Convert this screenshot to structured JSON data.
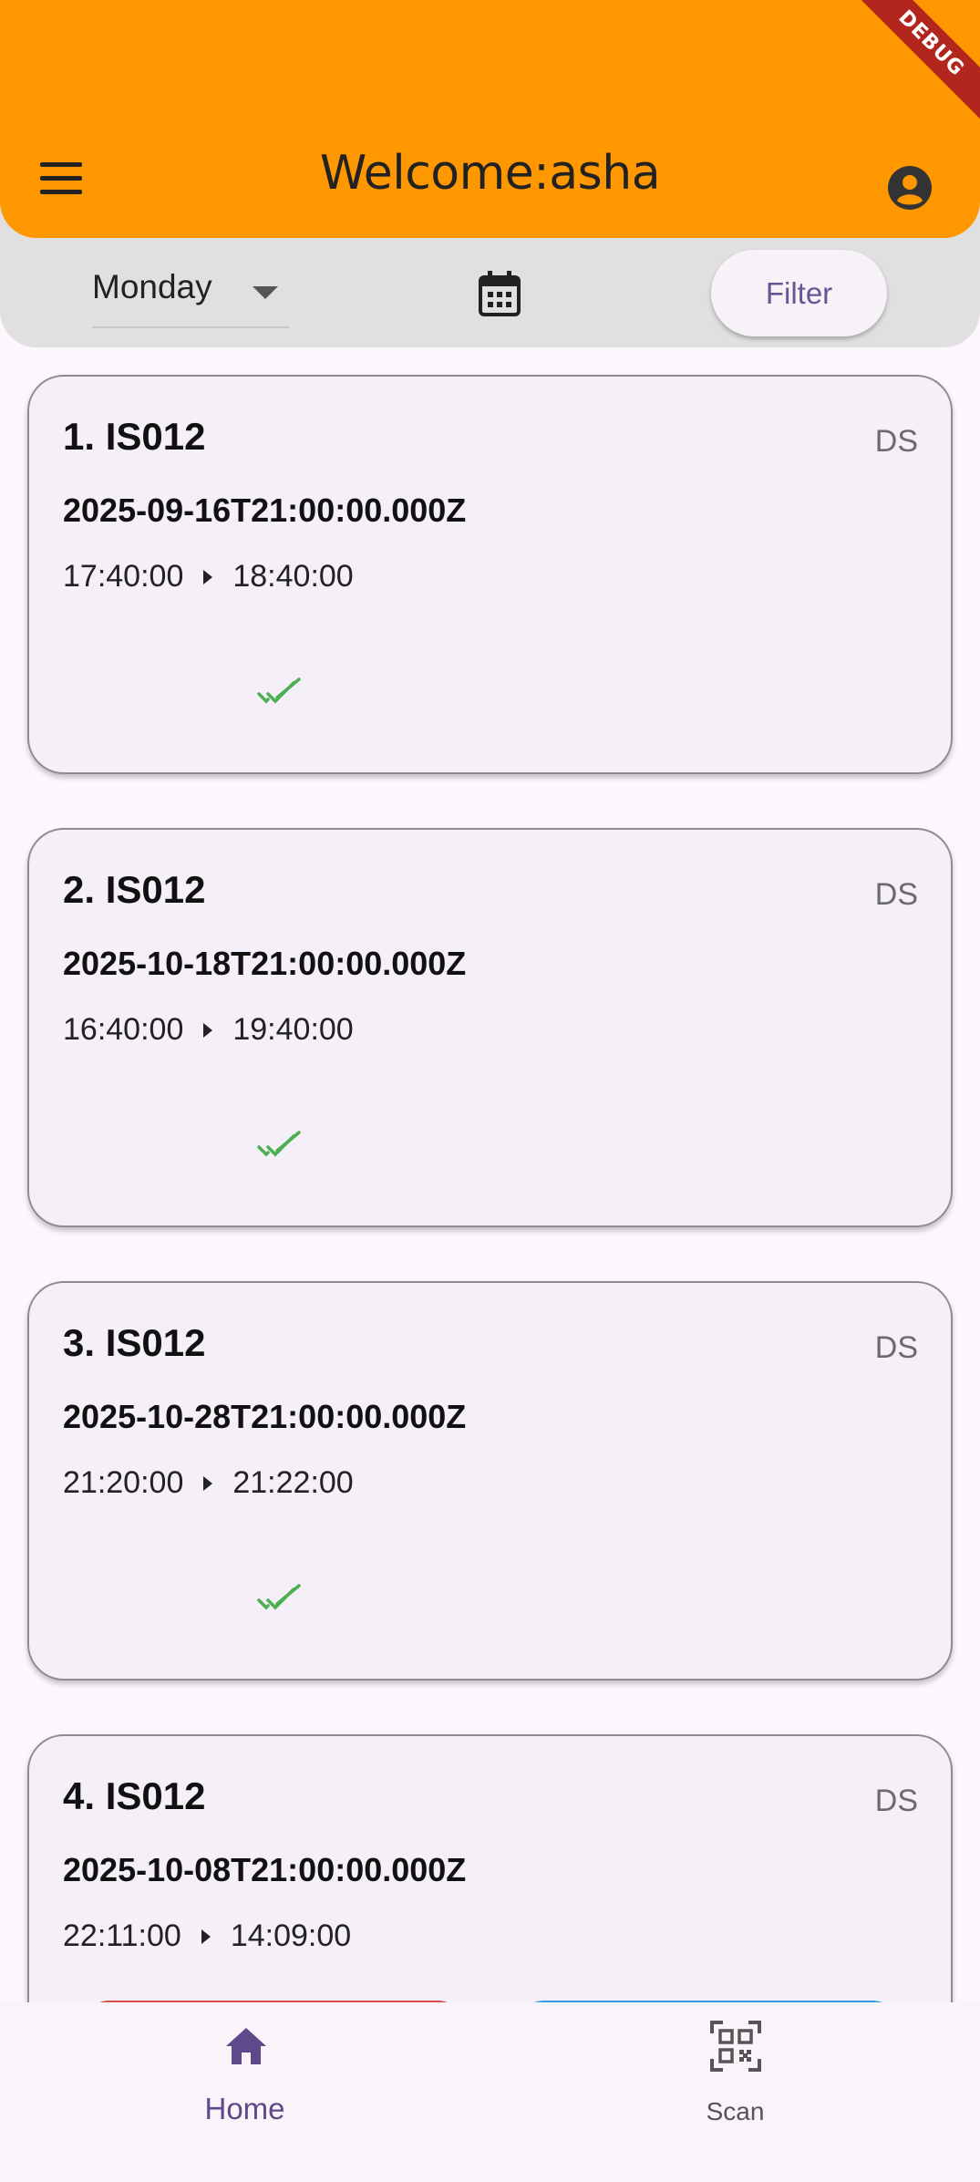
{
  "header": {
    "title": "Welcome:asha",
    "menu_icon": "menu-icon",
    "account_icon": "account-circle-icon",
    "color": "#ff9800"
  },
  "debug_banner": "DEBUG",
  "filters": {
    "day": "Monday",
    "calendar_icon": "calendar-icon",
    "filter_label": "Filter"
  },
  "cards": [
    {
      "title": "1. IS012",
      "badge": "DS",
      "date": "2025-09-16T21:00:00.000Z",
      "start": "17:40:00",
      "end": "18:40:00",
      "status_icon": "double-check-icon"
    },
    {
      "title": "2. IS012",
      "badge": "DS",
      "date": "2025-10-18T21:00:00.000Z",
      "start": "16:40:00",
      "end": "19:40:00",
      "status_icon": "double-check-icon"
    },
    {
      "title": "3. IS012",
      "badge": "DS",
      "date": "2025-10-28T21:00:00.000Z",
      "start": "21:20:00",
      "end": "21:22:00",
      "status_icon": "double-check-icon"
    },
    {
      "title": "4. IS012",
      "badge": "DS",
      "date": "2025-10-08T21:00:00.000Z",
      "start": "22:11:00",
      "end": "14:09:00",
      "status_icon": ""
    }
  ],
  "bottom_nav": {
    "items": [
      {
        "label": "Home",
        "icon": "home-icon",
        "active": true
      },
      {
        "label": "Scan",
        "icon": "qr-scan-icon",
        "active": false
      }
    ]
  },
  "colors": {
    "accent": "#ff9800",
    "check_green": "#4caf50",
    "primary_purple": "#6a5496",
    "button_red": "#d94b44",
    "button_blue": "#2f9be2"
  }
}
